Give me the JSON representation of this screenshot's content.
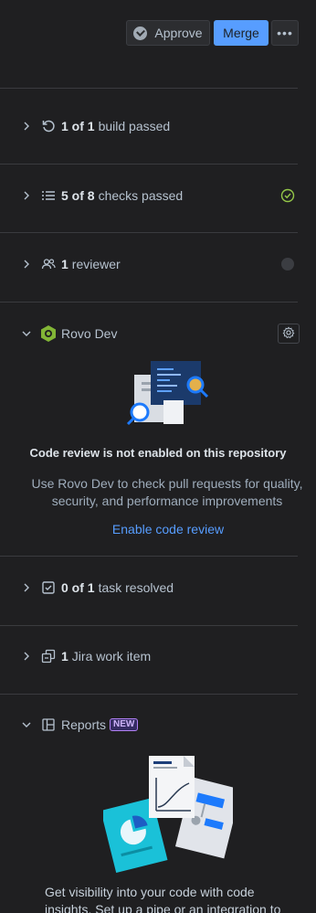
{
  "toolbar": {
    "approve_label": "Approve",
    "merge_label": "Merge",
    "more_label": "•••"
  },
  "build": {
    "count": "1 of 1",
    "text": "build passed"
  },
  "checks": {
    "count": "5 of 8",
    "text": "checks passed"
  },
  "reviewers": {
    "count": "1",
    "text": "reviewer"
  },
  "rovo": {
    "title": "Rovo Dev",
    "heading": "Code review is not enabled on this repository",
    "description": "Use Rovo Dev to check pull requests for quality, security, and performance improvements",
    "link": "Enable code review"
  },
  "tasks": {
    "count": "0 of 1",
    "text": "task resolved"
  },
  "jira": {
    "count": "1",
    "text": "Jira work item"
  },
  "reports": {
    "title": "Reports",
    "badge": "NEW",
    "description": "Get visibility into your code with code insights. Set up a pipe or an integration to"
  },
  "colors": {
    "accent": "#579dff",
    "success": "#7ee2b8",
    "rovo_green": "#6a9a23",
    "new_badge": "#b180f5"
  }
}
